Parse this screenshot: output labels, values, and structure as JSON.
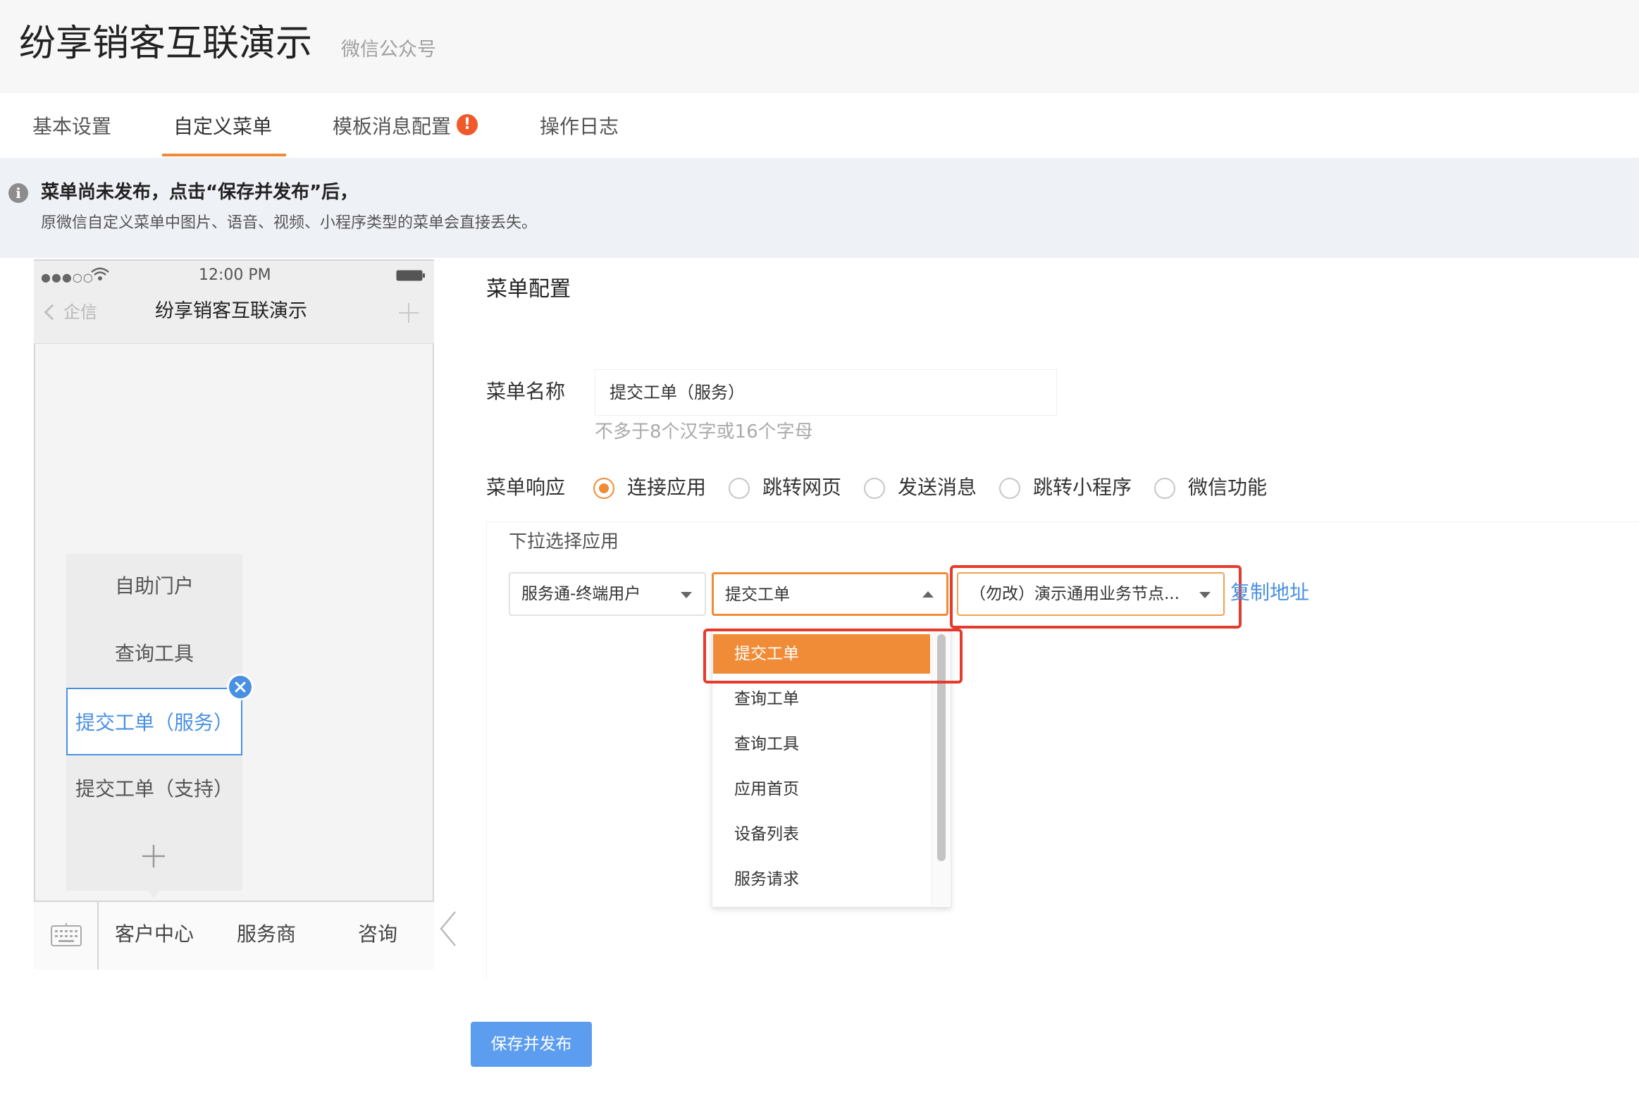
{
  "header": {
    "title": "纷享销客互联演示",
    "subtitle": "微信公众号"
  },
  "tabs": [
    {
      "label": "基本设置"
    },
    {
      "label": "自定义菜单",
      "active": true
    },
    {
      "label": "模板消息配置",
      "badge": "!"
    },
    {
      "label": "操作日志"
    }
  ],
  "notice": {
    "icon": "info-icon",
    "line1": "菜单尚未发布，点击“保存并发布”后，",
    "line2": "原微信自定义菜单中图片、语音、视频、小程序类型的菜单会直接丢失。"
  },
  "phone": {
    "status_time": "12:00 PM",
    "signal": "●●●○○",
    "back_label": "企信",
    "title": "纷享销客互联演示",
    "submenu": [
      {
        "label": "自助门户"
      },
      {
        "label": "查询工具"
      },
      {
        "label": "提交工单（服务）",
        "selected": true
      },
      {
        "label": "提交工单（支持）"
      }
    ],
    "bottom_menu": [
      {
        "label": "客户中心"
      },
      {
        "label": "服务商"
      },
      {
        "label": "咨询"
      }
    ]
  },
  "config": {
    "title": "菜单配置",
    "name_label": "菜单名称",
    "name_value": "提交工单（服务）",
    "name_hint": "不多于8个汉字或16个字母",
    "response_label": "菜单响应",
    "response_options": [
      {
        "label": "连接应用",
        "checked": true
      },
      {
        "label": "跳转网页"
      },
      {
        "label": "发送消息"
      },
      {
        "label": "跳转小程序"
      },
      {
        "label": "微信功能"
      }
    ],
    "app_box_title": "下拉选择应用",
    "select1": "服务通-终端用户",
    "select2": "提交工单",
    "select3": "（勿改）演示通用业务节点...",
    "copy_link": "复制地址",
    "dropdown_options": [
      {
        "label": "提交工单",
        "active": true
      },
      {
        "label": "查询工单"
      },
      {
        "label": "查询工具"
      },
      {
        "label": "应用首页"
      },
      {
        "label": "设备列表"
      },
      {
        "label": "服务请求"
      }
    ]
  },
  "actions": {
    "publish_label": "保存并发布"
  },
  "colors": {
    "accent": "#f08c38",
    "link": "#4a90e2",
    "highlight": "#e53b2c",
    "button": "#5c9df0"
  }
}
